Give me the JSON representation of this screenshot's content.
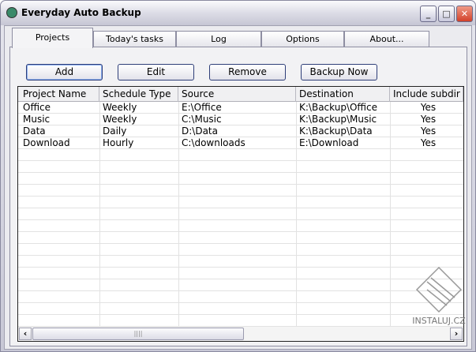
{
  "window": {
    "title": "Everyday Auto Backup"
  },
  "tabs": [
    {
      "label": "Projects"
    },
    {
      "label": "Today's tasks"
    },
    {
      "label": "Log"
    },
    {
      "label": "Options"
    },
    {
      "label": "About..."
    }
  ],
  "toolbar": {
    "add": "Add",
    "edit": "Edit",
    "remove": "Remove",
    "backup_now": "Backup Now"
  },
  "table": {
    "columns": [
      "Project Name",
      "Schedule Type",
      "Source",
      "Destination",
      "Include subdir"
    ],
    "rows": [
      [
        "Office",
        "Weekly",
        "E:\\Office",
        "K:\\Backup\\Office",
        "Yes"
      ],
      [
        "Music",
        "Weekly",
        "C:\\Music",
        "K:\\Backup\\Music",
        "Yes"
      ],
      [
        "Data",
        "Daily",
        "D:\\Data",
        "K:\\Backup\\Data",
        "Yes"
      ],
      [
        "Download",
        "Hourly",
        "C:\\downloads",
        "E:\\Download",
        "Yes"
      ]
    ]
  },
  "watermark": "INSTALUJ.CZ"
}
